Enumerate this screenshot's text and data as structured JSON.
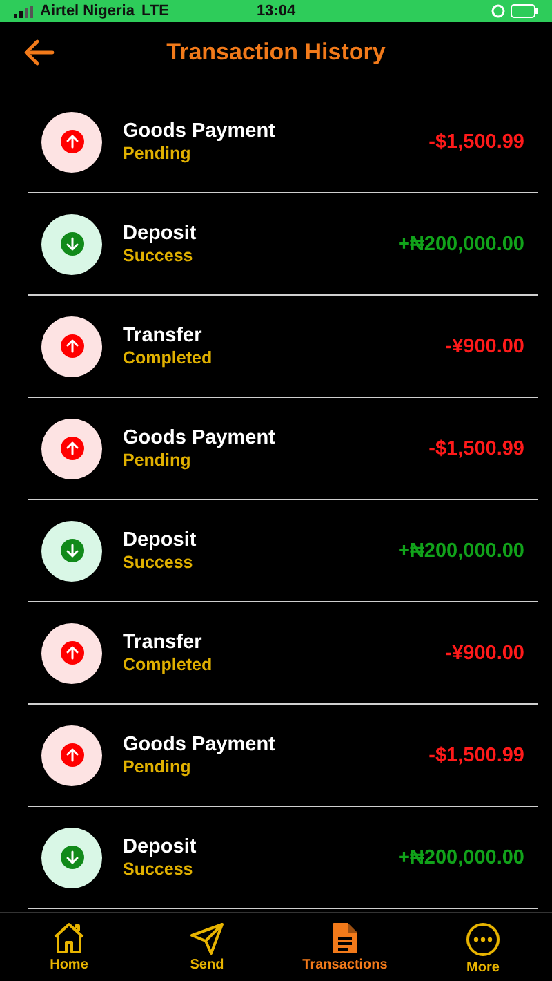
{
  "status_bar": {
    "carrier": "Airtel Nigeria",
    "network": "LTE",
    "time": "13:04"
  },
  "header": {
    "title": "Transaction History"
  },
  "transactions": [
    {
      "kind": "debit",
      "title": "Goods Payment",
      "status": "Pending",
      "amount": "-$1,500.99"
    },
    {
      "kind": "credit",
      "title": "Deposit",
      "status": "Success",
      "amount": "+₦200,000.00"
    },
    {
      "kind": "debit",
      "title": "Transfer",
      "status": "Completed",
      "amount": "-¥900.00"
    },
    {
      "kind": "debit",
      "title": "Goods Payment",
      "status": "Pending",
      "amount": "-$1,500.99"
    },
    {
      "kind": "credit",
      "title": "Deposit",
      "status": "Success",
      "amount": "+₦200,000.00"
    },
    {
      "kind": "debit",
      "title": "Transfer",
      "status": "Completed",
      "amount": "-¥900.00"
    },
    {
      "kind": "debit",
      "title": "Goods Payment",
      "status": "Pending",
      "amount": "-$1,500.99"
    },
    {
      "kind": "credit",
      "title": "Deposit",
      "status": "Success",
      "amount": "+₦200,000.00"
    }
  ],
  "nav": [
    {
      "kind": "home",
      "label": "Home",
      "selected": false
    },
    {
      "kind": "send",
      "label": "Send",
      "selected": false
    },
    {
      "kind": "transactions",
      "label": "Transactions",
      "selected": true
    },
    {
      "kind": "more",
      "label": "More",
      "selected": false
    }
  ]
}
